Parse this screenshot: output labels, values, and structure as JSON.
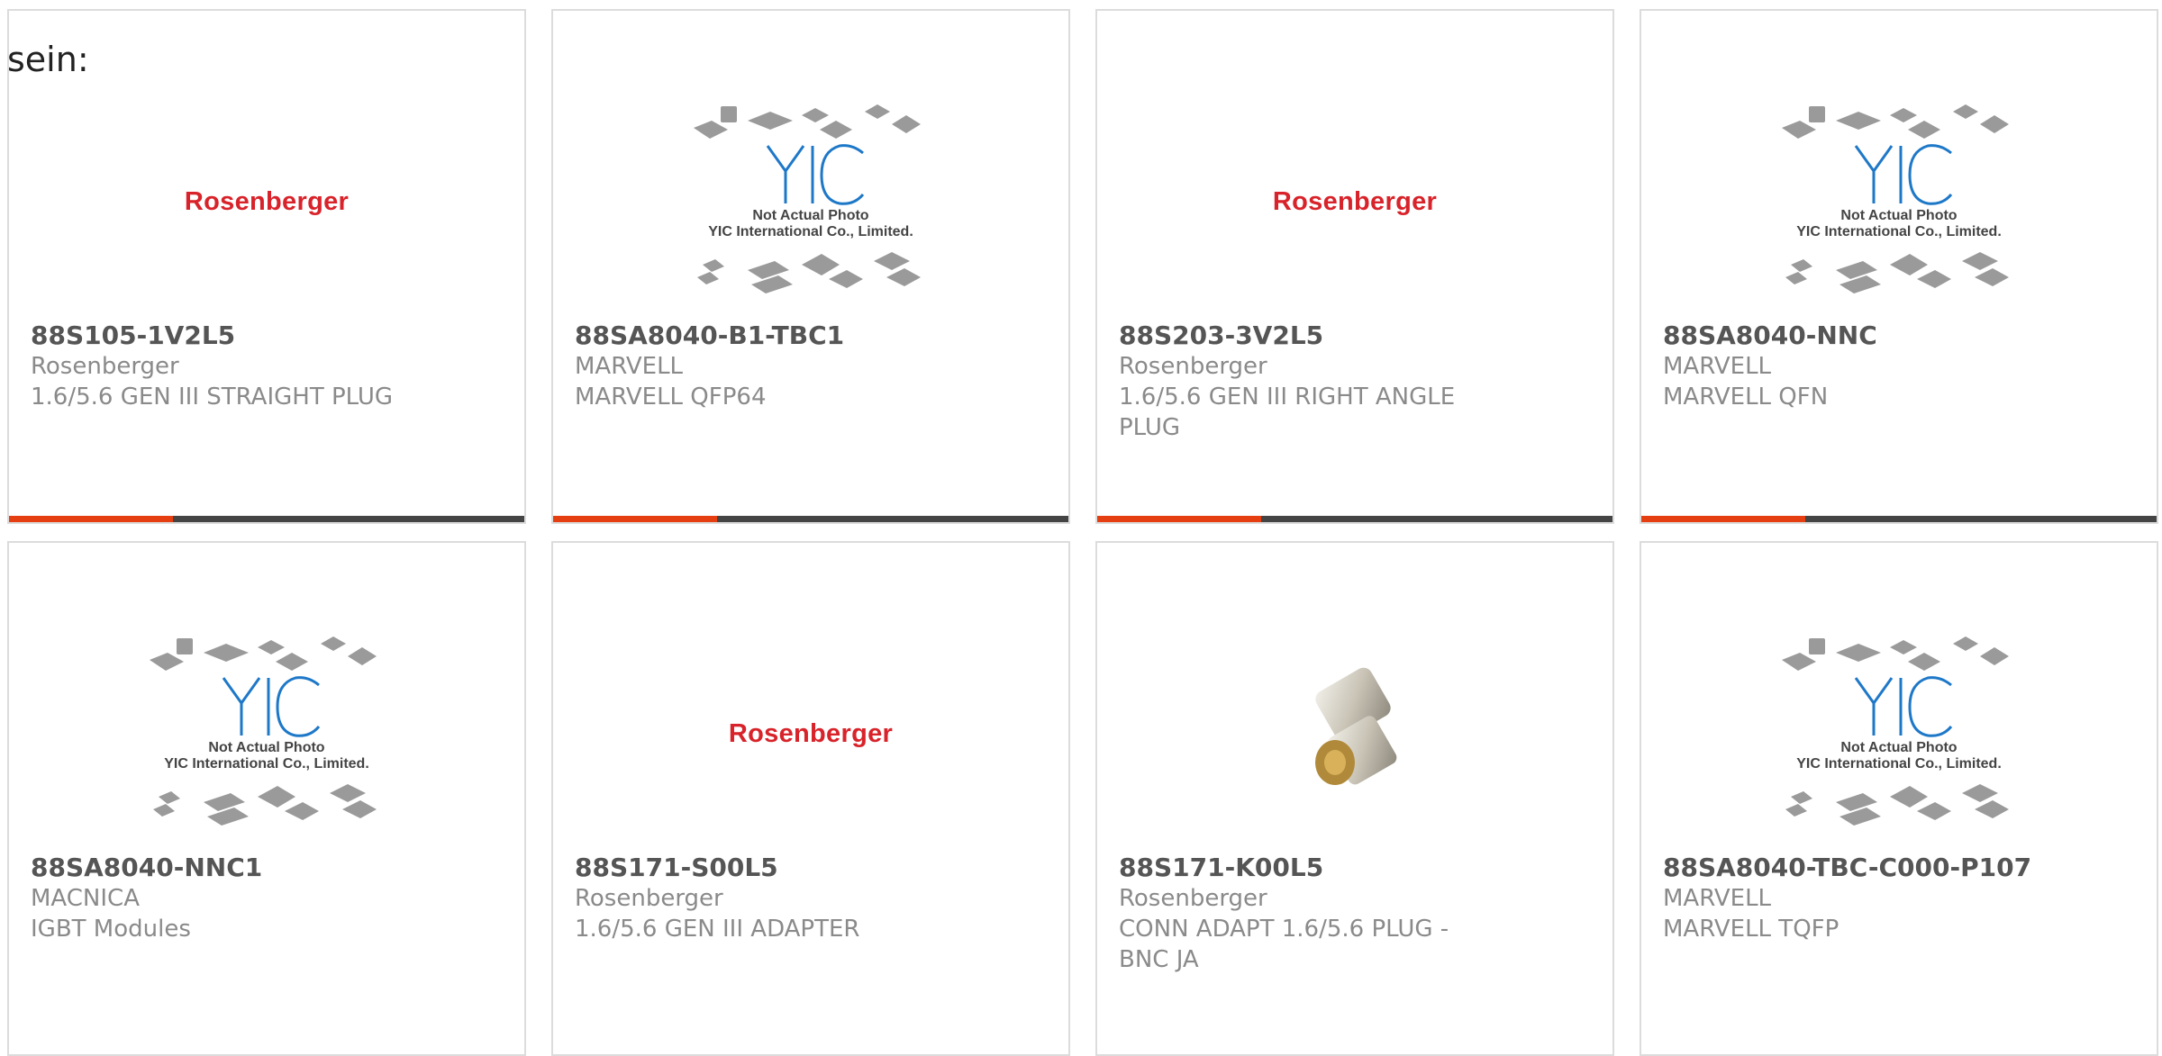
{
  "top_text": "sein:",
  "cards": [
    {
      "part_no": "88S105-1V2L5",
      "manufacturer": "Rosenberger",
      "description": "1.6/5.6 GEN III STRAIGHT PLUG",
      "image": "rosenberger-logo",
      "logo_text": "Rosenberger",
      "has_bar": true
    },
    {
      "part_no": "88SA8040-B1-TBC1",
      "manufacturer": "MARVELL",
      "description": "MARVELL QFP64",
      "image": "yic-placeholder",
      "has_bar": true
    },
    {
      "part_no": "88S203-3V2L5",
      "manufacturer": "Rosenberger",
      "description": "1.6/5.6 GEN III RIGHT ANGLE PLUG",
      "image": "rosenberger-logo",
      "logo_text": "Rosenberger",
      "has_bar": true
    },
    {
      "part_no": "88SA8040-NNC",
      "manufacturer": "MARVELL",
      "description": "MARVELL QFN",
      "image": "yic-placeholder",
      "has_bar": true
    },
    {
      "part_no": "88SA8040-NNC1",
      "manufacturer": "MACNICA",
      "description": "IGBT Modules",
      "image": "yic-placeholder",
      "has_bar": false
    },
    {
      "part_no": "88S171-S00L5",
      "manufacturer": "Rosenberger",
      "description": "1.6/5.6 GEN III ADAPTER",
      "image": "rosenberger-logo",
      "logo_text": "Rosenberger",
      "has_bar": false
    },
    {
      "part_no": "88S171-K00L5",
      "manufacturer": "Rosenberger",
      "description": "CONN ADAPT 1.6/5.6 PLUG - BNC JA",
      "image": "connector-photo",
      "has_bar": false
    },
    {
      "part_no": "88SA8040-TBC-C000-P107",
      "manufacturer": "MARVELL",
      "description": "MARVELL TQFP",
      "image": "yic-placeholder",
      "has_bar": false
    }
  ],
  "placeholder": {
    "logo": "YIC",
    "line1": "Not Actual Photo",
    "line2": "YIC International Co., Limited."
  },
  "colors": {
    "accent": "#e53e11",
    "bar": "#444444",
    "logo_red": "#d8232a",
    "yic_blue": "#1e78c8"
  }
}
